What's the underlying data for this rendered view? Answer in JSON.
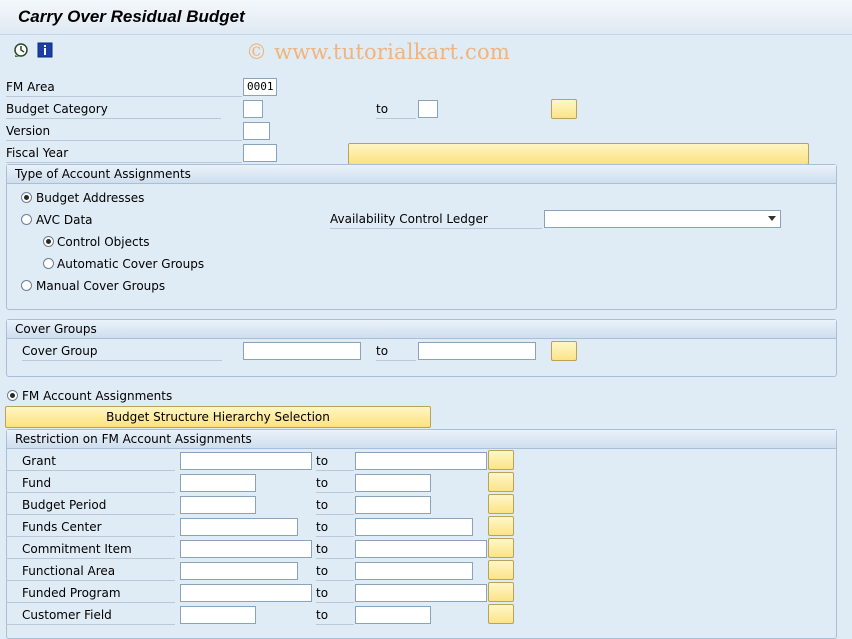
{
  "window": {
    "title": "Carry Over Residual Budget"
  },
  "watermark": "© www.tutorialkart.com",
  "toolbar": {
    "icons": [
      "execute-clock-icon",
      "info-icon"
    ]
  },
  "header_fields": {
    "fm_area": {
      "label": "FM Area",
      "value": "0001"
    },
    "budget_category": {
      "label": "Budget Category",
      "to": "to",
      "value": "",
      "to_value": ""
    },
    "version": {
      "label": "Version",
      "value": ""
    },
    "fiscal_year": {
      "label": "Fiscal Year",
      "value": ""
    }
  },
  "account_assignments": {
    "title": "Type of Account Assignments",
    "budget_addresses": "Budget Addresses",
    "avc_data": "AVC Data",
    "control_objects": "Control Objects",
    "automatic_cover_groups": "Automatic Cover Groups",
    "manual_cover_groups": "Manual Cover Groups",
    "availability_ledger_label": "Availability Control Ledger",
    "availability_ledger_value": ""
  },
  "cover_groups": {
    "title": "Cover Groups",
    "cover_group_label": "Cover Group",
    "to": "to"
  },
  "fm_account": {
    "radio_label": "FM Account Assignments",
    "hierarchy_button": "Budget Structure Hierarchy Selection",
    "restriction_title": "Restriction on FM Account Assignments",
    "rows": [
      {
        "label": "Grant",
        "to": "to"
      },
      {
        "label": "Fund",
        "to": "to"
      },
      {
        "label": "Budget Period",
        "to": "to"
      },
      {
        "label": "Funds Center",
        "to": "to"
      },
      {
        "label": "Commitment Item",
        "to": "to"
      },
      {
        "label": "Functional Area",
        "to": "to"
      },
      {
        "label": "Funded Program",
        "to": "to"
      },
      {
        "label": "Customer Field",
        "to": "to"
      }
    ]
  }
}
